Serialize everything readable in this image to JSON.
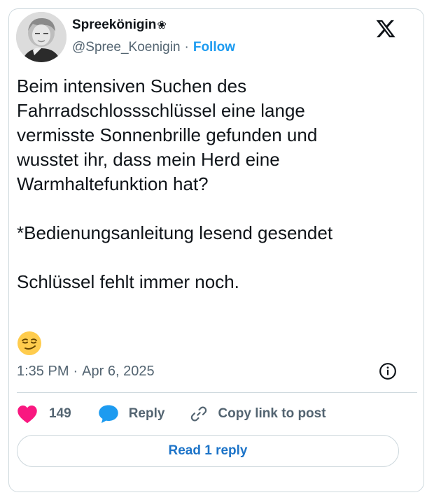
{
  "author": {
    "display_name": "Spreekönigin",
    "name_badge": "❀",
    "handle": "@Spree_Koenigin",
    "separator": "·",
    "follow_label": "Follow"
  },
  "tweet": {
    "text": "Beim intensiven Suchen des\nFahrradschlossschlüssel eine lange\nvermisste Sonnenbrille gefunden und\nwusstet ihr, dass mein Herd eine\nWarmhaltefunktion hat?\n\n*Bedienungsanleitung lesend gesendet\n\nSchlüssel fehlt immer noch.",
    "emoji": "smirking-face",
    "time": "1:35 PM",
    "date_separator": "·",
    "date": "Apr 6, 2025"
  },
  "actions": {
    "like_count": "149",
    "reply_label": "Reply",
    "copy_link_label": "Copy link to post"
  },
  "read_replies_label": "Read 1 reply",
  "colors": {
    "accent": "#1d9bf0",
    "like": "#f91880",
    "reply_icon": "#1d9bf0",
    "border": "#cfd9de",
    "secondary_text": "#536471"
  }
}
